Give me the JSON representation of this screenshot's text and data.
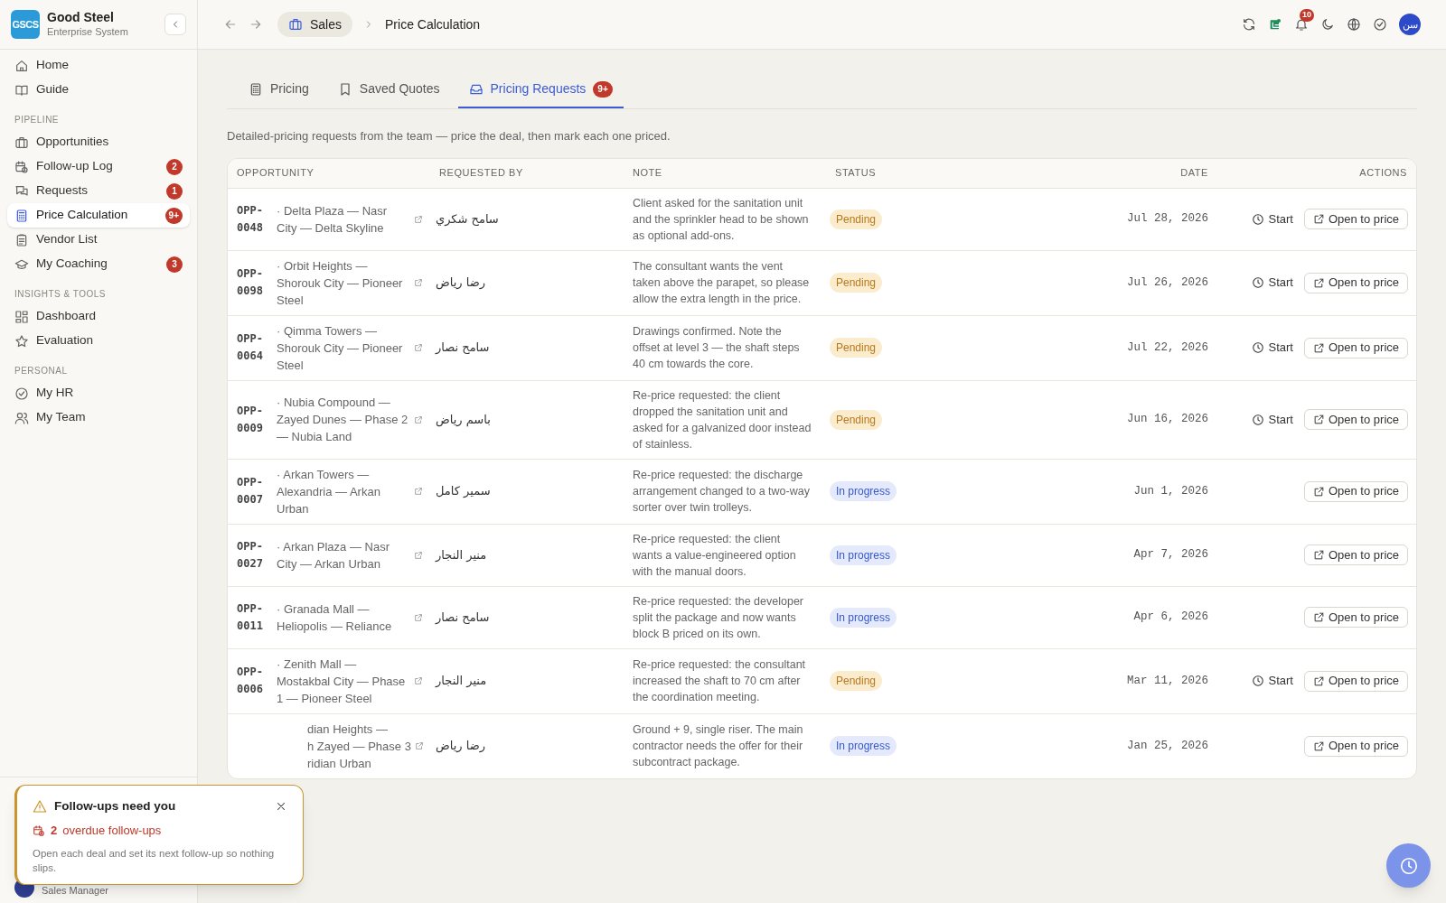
{
  "sidebar": {
    "brand": {
      "logo": "GSCS",
      "name": "Good Steel",
      "subtitle": "Enterprise System"
    },
    "groups": [
      {
        "items": [
          {
            "label": "Home",
            "selected": false
          },
          {
            "label": "Guide",
            "selected": false
          }
        ]
      },
      {
        "label": "PIPELINE",
        "items": [
          {
            "label": "Opportunities",
            "selected": false
          },
          {
            "label": "Follow-up Log",
            "badge": "2",
            "selected": false
          },
          {
            "label": "Requests",
            "badge": "1",
            "selected": false
          },
          {
            "label": "Price Calculation",
            "badge": "9+",
            "selected": true
          },
          {
            "label": "Vendor List",
            "selected": false
          },
          {
            "label": "My Coaching",
            "badge": "3",
            "selected": false
          }
        ]
      },
      {
        "label": "INSIGHTS & TOOLS",
        "items": [
          {
            "label": "Dashboard",
            "selected": false
          },
          {
            "label": "Evaluation",
            "selected": false
          }
        ]
      },
      {
        "label": "PERSONAL",
        "items": [
          {
            "label": "My HR",
            "selected": false
          },
          {
            "label": "My Team",
            "selected": false
          }
        ]
      }
    ],
    "footer": {
      "role": "Sales Manager"
    }
  },
  "header": {
    "breadcrumb": [
      {
        "label": "Sales",
        "kind": "chip"
      },
      {
        "label": "Price Calculation",
        "kind": "current"
      }
    ],
    "notification_count": "10",
    "avatar": "سن"
  },
  "tabs": [
    {
      "label": "Pricing",
      "selected": false
    },
    {
      "label": "Saved Quotes",
      "selected": false
    },
    {
      "label": "Pricing Requests",
      "badge": "9+",
      "selected": true
    }
  ],
  "description": "Detailed-pricing requests from the team — price the deal, then mark each one priced.",
  "table": {
    "columns": [
      "OPPORTUNITY",
      "REQUESTED BY",
      "NOTE",
      "STATUS",
      "DATE",
      "ACTIONS"
    ],
    "rows": [
      {
        "id": "OPP-0048",
        "name": "· Delta Plaza — Nasr City — Delta Skyline",
        "requested_by": "سامح شكري",
        "note": "Client asked for the sanitation unit and the sprinkler head to be shown as optional add-ons.",
        "status": {
          "label": "Pending",
          "kind": "pending"
        },
        "date": "Jul 28, 2026",
        "start": "Start",
        "action": "Open to price"
      },
      {
        "id": "OPP-0098",
        "name": "· Orbit Heights — Shorouk City — Pioneer Steel",
        "requested_by": "رضا رياض",
        "note": "The consultant wants the vent taken above the parapet, so please allow the extra length in the price.",
        "status": {
          "label": "Pending",
          "kind": "pending"
        },
        "date": "Jul 26, 2026",
        "start": "Start",
        "action": "Open to price"
      },
      {
        "id": "OPP-0064",
        "name": "· Qimma Towers — Shorouk City — Pioneer Steel",
        "requested_by": "سامح نصار",
        "note": "Drawings confirmed. Note the offset at level 3 — the shaft steps 40 cm towards the core.",
        "status": {
          "label": "Pending",
          "kind": "pending"
        },
        "date": "Jul 22, 2026",
        "start": "Start",
        "action": "Open to price"
      },
      {
        "id": "OPP-0009",
        "name": "· Nubia Compound — Zayed Dunes — Phase 2 — Nubia Land",
        "requested_by": "باسم رياض",
        "note": "Re-price requested: the client dropped the sanitation unit and asked for a galvanized door instead of stainless.",
        "status": {
          "label": "Pending",
          "kind": "pending"
        },
        "date": "Jun 16, 2026",
        "start": "Start",
        "action": "Open to price"
      },
      {
        "id": "OPP-0007",
        "name": "· Arkan Towers — Alexandria — Arkan Urban",
        "requested_by": "سمير كامل",
        "note": "Re-price requested: the discharge arrangement changed to a two-way sorter over twin trolleys.",
        "status": {
          "label": "In progress",
          "kind": "progress"
        },
        "date": "Jun 1, 2026",
        "action": "Open to price"
      },
      {
        "id": "OPP-0027",
        "name": "· Arkan Plaza — Nasr City — Arkan Urban",
        "requested_by": "منير النجار",
        "note": "Re-price requested: the client wants a value-engineered option with the manual doors.",
        "status": {
          "label": "In progress",
          "kind": "progress"
        },
        "date": "Apr 7, 2026",
        "action": "Open to price"
      },
      {
        "id": "OPP-0011",
        "name": "· Granada Mall — Heliopolis — Reliance",
        "requested_by": "سامح نصار",
        "note": "Re-price requested: the developer split the package and now wants block B priced on its own.",
        "status": {
          "label": "In progress",
          "kind": "progress"
        },
        "date": "Apr 6, 2026",
        "action": "Open to price"
      },
      {
        "id": "OPP-0006",
        "name": "· Zenith Mall — Mostakbal City — Phase 1 — Pioneer Steel",
        "requested_by": "منير النجار",
        "note": "Re-price requested: the consultant increased the shaft to 70 cm after the coordination meeting.",
        "status": {
          "label": "Pending",
          "kind": "pending"
        },
        "date": "Mar 11, 2026",
        "start": "Start",
        "action": "Open to price"
      },
      {
        "name_lines": [
          "dian Heights —",
          "h Zayed — Phase 3",
          "ridian Urban"
        ],
        "requested_by": "رضا رياض",
        "note": "Ground + 9, single riser. The main contractor needs the offer for their subcontract package.",
        "status": {
          "label": "In progress",
          "kind": "progress"
        },
        "date": "Jan 25, 2026",
        "action": "Open to price"
      }
    ]
  },
  "toast": {
    "title": "Follow-ups need you",
    "count": "2",
    "count_label": "overdue follow-ups",
    "text": "Open each deal and set its next follow-up so nothing slips."
  }
}
